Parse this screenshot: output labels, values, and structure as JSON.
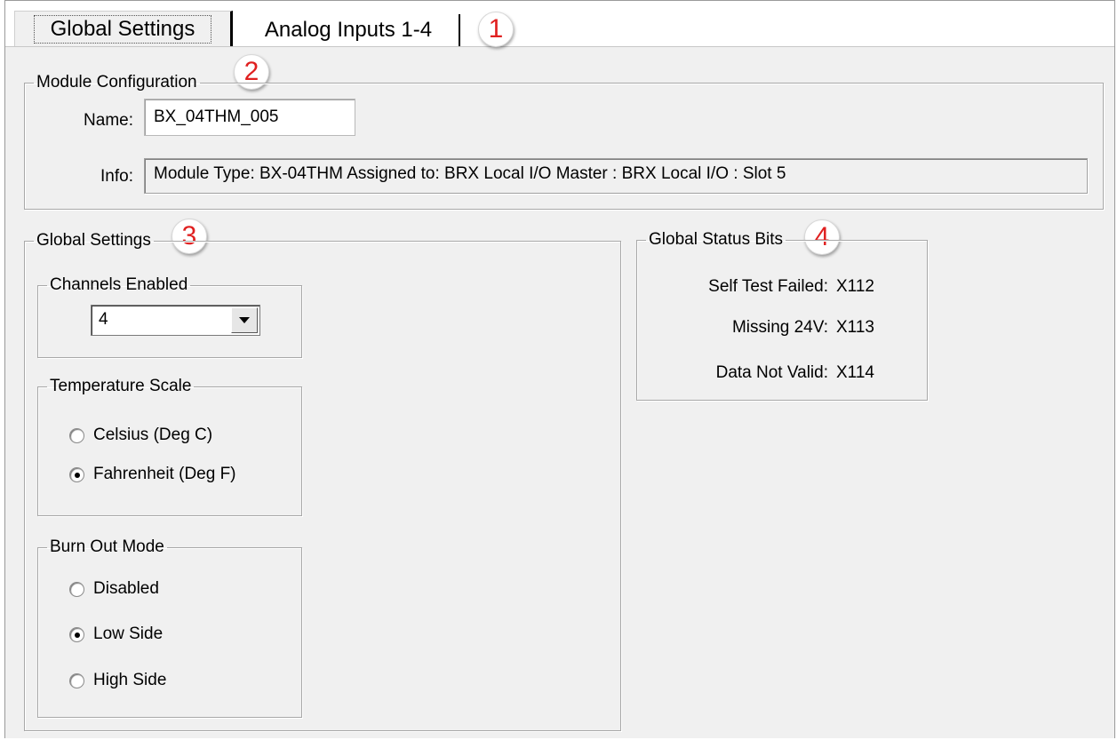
{
  "tabs": [
    {
      "label": "Global Settings",
      "active": true
    },
    {
      "label": "Analog Inputs 1-4",
      "active": false
    }
  ],
  "callouts": [
    "1",
    "2",
    "3",
    "4"
  ],
  "module_configuration": {
    "title": "Module Configuration",
    "name_label": "Name:",
    "name_value": "BX_04THM_005",
    "info_label": "Info:",
    "info_value": "Module Type: BX-04THM   Assigned to: BRX Local I/O Master : BRX Local I/O : Slot 5"
  },
  "global_settings": {
    "title": "Global Settings",
    "channels_enabled": {
      "title": "Channels Enabled",
      "selected": "4"
    },
    "temperature_scale": {
      "title": "Temperature Scale",
      "options": [
        {
          "label": "Celsius (Deg C)",
          "selected": false
        },
        {
          "label": "Fahrenheit (Deg F)",
          "selected": true
        }
      ]
    },
    "burn_out_mode": {
      "title": "Burn Out Mode",
      "options": [
        {
          "label": "Disabled",
          "selected": false
        },
        {
          "label": "Low Side",
          "selected": true
        },
        {
          "label": "High Side",
          "selected": false
        }
      ]
    }
  },
  "global_status_bits": {
    "title": "Global Status Bits",
    "rows": [
      {
        "label": "Self Test Failed:",
        "value": "X112"
      },
      {
        "label": "Missing 24V:",
        "value": "X113"
      },
      {
        "label": "Data Not Valid:",
        "value": "X114"
      }
    ]
  },
  "colors": {
    "callout_number": "#e02020",
    "panel_background": "#f0f0f0"
  }
}
